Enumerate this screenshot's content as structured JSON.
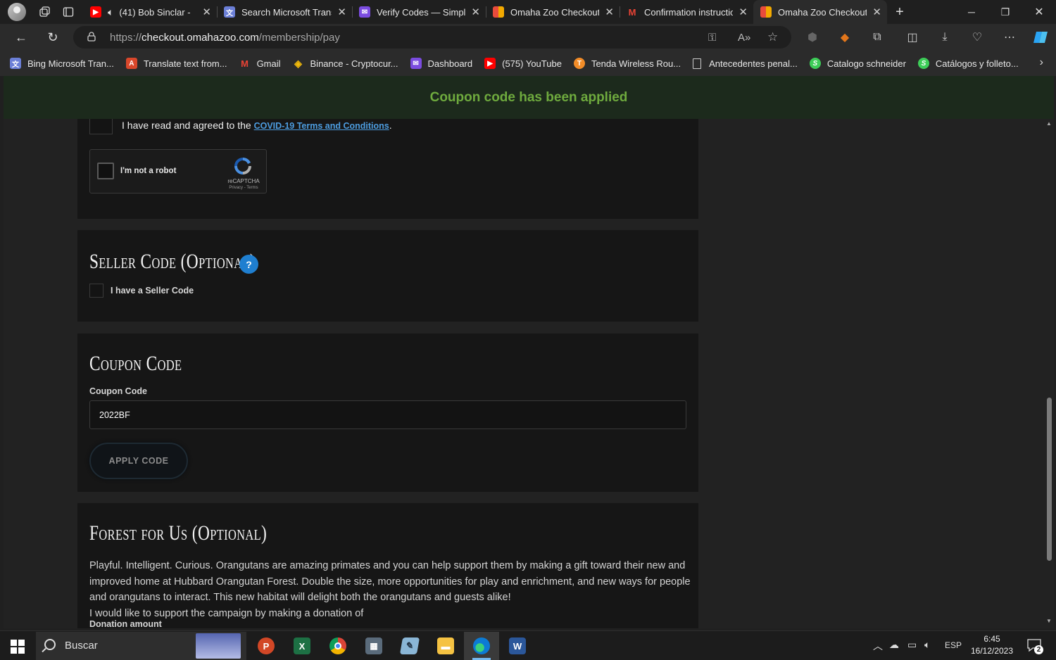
{
  "browser": {
    "tabs": [
      {
        "title": "(41) Bob Sinclar -",
        "favicon": "youtube-icon",
        "color": "#ff0000",
        "audio": true
      },
      {
        "title": "Search Microsoft Trans",
        "favicon": "translator-icon",
        "color": "#6b7fd7"
      },
      {
        "title": "Verify Codes — Simply",
        "favicon": "mail-icon",
        "color": "#7b4ce0"
      },
      {
        "title": "Omaha Zoo Checkout",
        "favicon": "omaha-zoo-icon",
        "color": "#f2a900"
      },
      {
        "title": "Confirmation instructio",
        "favicon": "gmail-icon",
        "color": "#ea4335"
      },
      {
        "title": "Omaha Zoo Checkout",
        "favicon": "omaha-zoo-icon",
        "color": "#f2a900",
        "active": true
      }
    ],
    "url_prefix": "https://",
    "url_domain": "checkout.omahazoo.com",
    "url_path": "/membership/pay",
    "bookmarks": [
      {
        "label": "Bing Microsoft Tran...",
        "icon": "translator-icon"
      },
      {
        "label": "Translate text from...",
        "icon": "translate-icon"
      },
      {
        "label": "Gmail",
        "icon": "gmail-icon"
      },
      {
        "label": "Binance - Cryptocur...",
        "icon": "binance-icon"
      },
      {
        "label": "Dashboard",
        "icon": "mail-icon"
      },
      {
        "label": "(575) YouTube",
        "icon": "youtube-icon"
      },
      {
        "label": "Tenda Wireless Rou...",
        "icon": "tenda-icon"
      },
      {
        "label": "Antecedentes penal...",
        "icon": "document-icon"
      },
      {
        "label": "Catalogo schneider",
        "icon": "schneider-icon"
      },
      {
        "label": "Catálogos y folleto...",
        "icon": "schneider-icon"
      }
    ]
  },
  "page": {
    "banner": "Coupon code has been applied",
    "terms": {
      "prefix": "I have read and agreed to the ",
      "link": "COVID-19 Terms and Conditions",
      "suffix": "."
    },
    "recaptcha": {
      "label": "I'm not a robot",
      "brand": "reCAPTCHA",
      "terms": "Privacy - Terms"
    },
    "seller": {
      "heading": "Seller Code (Optional)",
      "help": "?",
      "checkbox_label": "I have a Seller Code"
    },
    "coupon": {
      "heading": "Coupon Code",
      "field_label": "Coupon Code",
      "value": "2022BF",
      "button": "APPLY CODE"
    },
    "forest": {
      "heading": "Forest for Us (Optional)",
      "paragraph": "Playful. Intelligent. Curious. Orangutans are amazing primates and you can help support them by making a gift toward their new and improved home at Hubbard Orangutan Forest. Double the size, more opportunities for play and enrichment, and new ways for people and orangutans to interact. This new habitat will delight both the orangutans and guests alike!",
      "donation_text": "I would like to support the campaign by making a donation of",
      "donation_label": "Donation amount"
    }
  },
  "taskbar": {
    "search_placeholder": "Buscar",
    "language": "ESP",
    "time": "6:45",
    "date": "16/12/2023",
    "notifications": "2"
  },
  "colors": {
    "banner_text": "#6fab3e",
    "link": "#4d9de0",
    "help_badge": "#1f7fd0"
  }
}
